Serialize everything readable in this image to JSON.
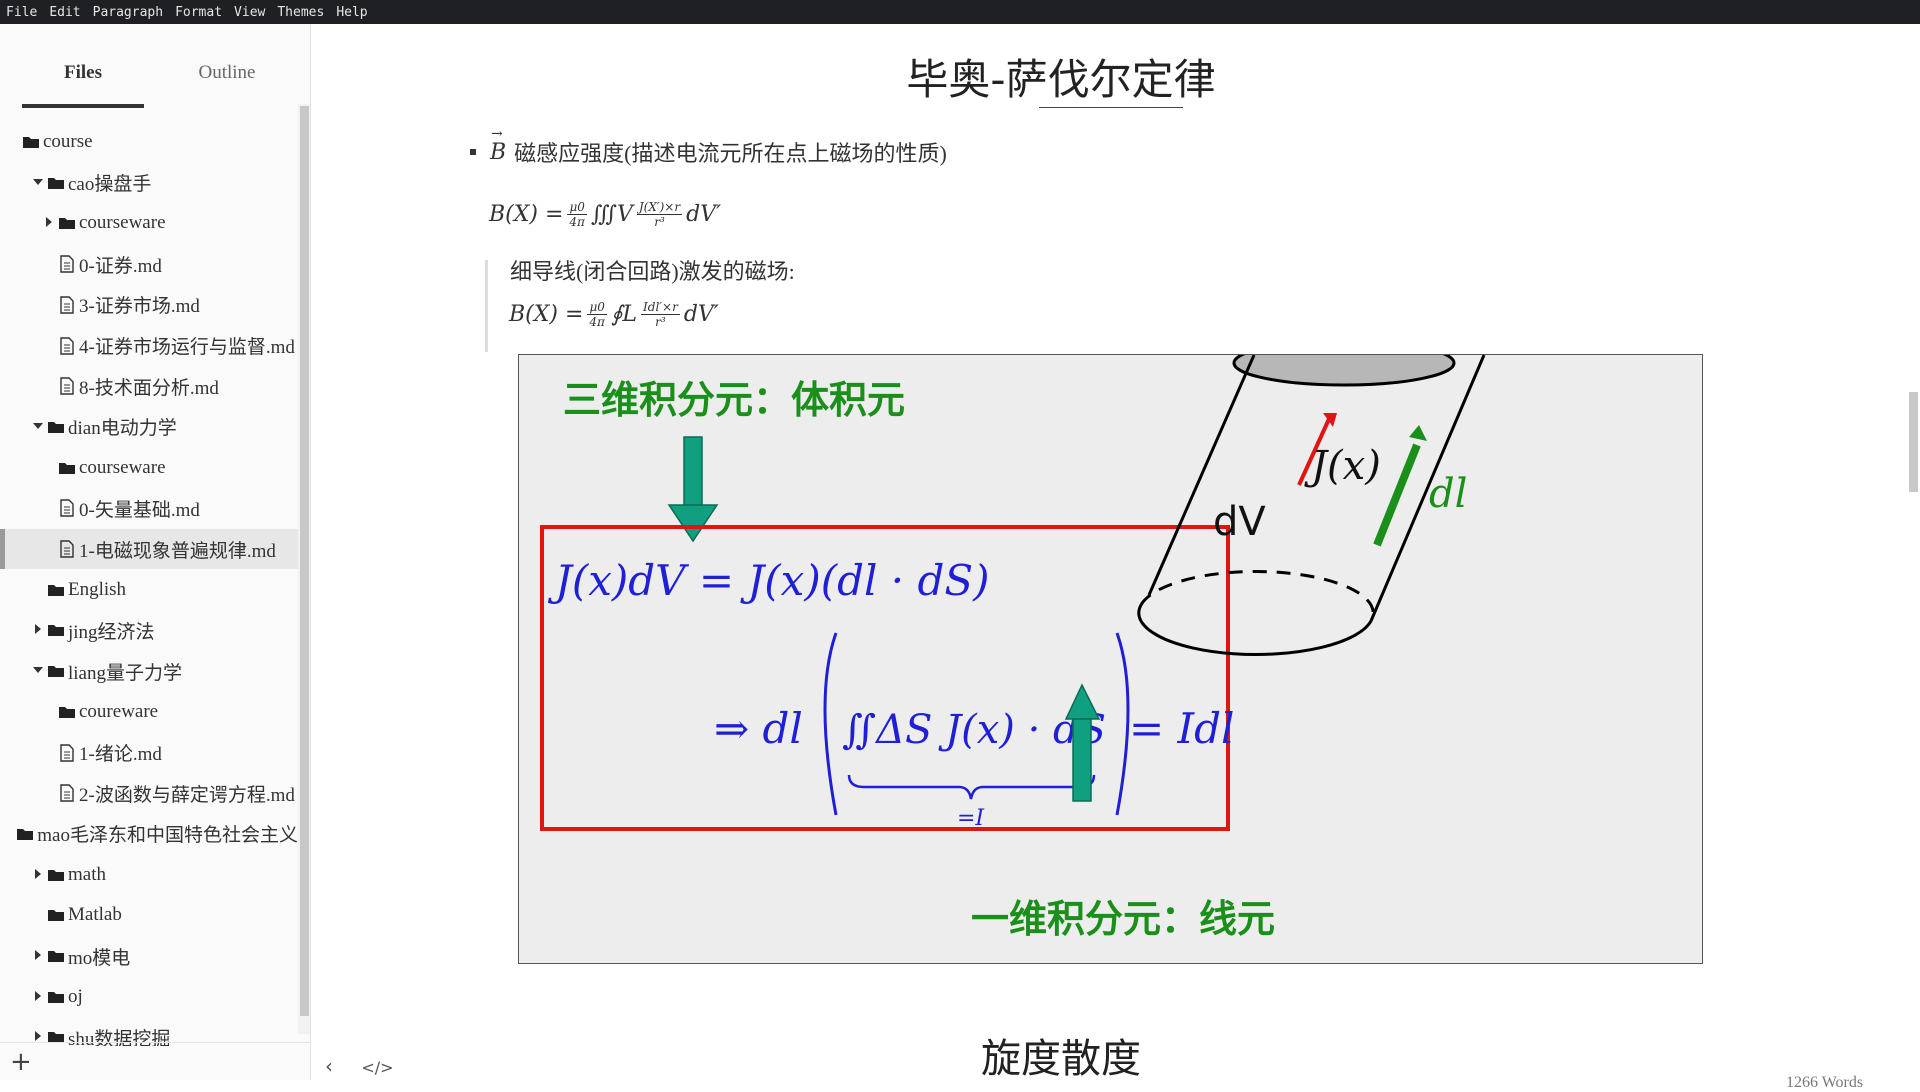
{
  "menu": [
    "File",
    "Edit",
    "Paragraph",
    "Format",
    "View",
    "Themes",
    "Help"
  ],
  "sidebar": {
    "tabs": [
      {
        "label": "Files"
      },
      {
        "label": "Outline"
      }
    ],
    "tree": [
      {
        "label": "course",
        "type": "folder",
        "arrow": "none",
        "depth": 0
      },
      {
        "label": "cao操盘手",
        "type": "folder",
        "arrow": "down",
        "depth": 1
      },
      {
        "label": "courseware",
        "type": "folder",
        "arrow": "right",
        "depth": 2
      },
      {
        "label": "0-证券.md",
        "type": "file",
        "arrow": "none",
        "depth": 2
      },
      {
        "label": "3-证券市场.md",
        "type": "file",
        "arrow": "none",
        "depth": 2
      },
      {
        "label": "4-证券市场运行与监督.md",
        "type": "file",
        "arrow": "none",
        "depth": 2
      },
      {
        "label": "8-技术面分析.md",
        "type": "file",
        "arrow": "none",
        "depth": 2
      },
      {
        "label": "dian电动力学",
        "type": "folder",
        "arrow": "down",
        "depth": 1
      },
      {
        "label": "courseware",
        "type": "folder",
        "arrow": "none",
        "depth": 2
      },
      {
        "label": "0-矢量基础.md",
        "type": "file",
        "arrow": "none",
        "depth": 2
      },
      {
        "label": "1-电磁现象普遍规律.md",
        "type": "file",
        "arrow": "none",
        "depth": 2,
        "active": true
      },
      {
        "label": "English",
        "type": "folder",
        "arrow": "none",
        "depth": 1
      },
      {
        "label": "jing经济法",
        "type": "folder",
        "arrow": "right",
        "depth": 1
      },
      {
        "label": "liang量子力学",
        "type": "folder",
        "arrow": "down",
        "depth": 1
      },
      {
        "label": "coureware",
        "type": "folder",
        "arrow": "none",
        "depth": 2
      },
      {
        "label": "1-绪论.md",
        "type": "file",
        "arrow": "none",
        "depth": 2
      },
      {
        "label": "2-波函数与薛定谔方程.md",
        "type": "file",
        "arrow": "none",
        "depth": 2
      },
      {
        "label": "mao毛泽东和中国特色社会主义",
        "type": "folder",
        "arrow": "none",
        "depth": 1
      },
      {
        "label": "math",
        "type": "folder",
        "arrow": "right",
        "depth": 1
      },
      {
        "label": "Matlab",
        "type": "folder",
        "arrow": "none",
        "depth": 1
      },
      {
        "label": "mo模电",
        "type": "folder",
        "arrow": "right",
        "depth": 1
      },
      {
        "label": "oj",
        "type": "folder",
        "arrow": "right",
        "depth": 1
      },
      {
        "label": "shu数据挖掘",
        "type": "folder",
        "arrow": "right",
        "depth": 1
      }
    ],
    "add_label": "+"
  },
  "doc": {
    "title": "毕奥-萨伐尔定律",
    "bullet_B": "B",
    "bullet_text": "磁感应强度(描述电流元所在点上磁场的性质)",
    "formula1": {
      "lhs": "B(X) =",
      "frac1_num": "μ0",
      "frac1_den": "4π",
      "integral": "∭V",
      "frac2_num": "J(X′)×r",
      "frac2_den": "r³",
      "tail": "dV′"
    },
    "quote_text": "细导线(闭合回路)激发的磁场:",
    "formula2": {
      "lhs": "B(X) =",
      "frac1_num": "μ0",
      "frac1_den": "4π",
      "integral": "∮L",
      "frac2_num": "Idl′×r",
      "frac2_den": "r³",
      "tail": "dV′"
    },
    "figure": {
      "label_3d": "三维积分元：体积元",
      "label_1d": "一维积分元：线元",
      "eq1": "J(x)dV = J(x)(dl · dS)",
      "eq2_left": "⇒ dl",
      "eq2_integral": "∬ΔS J(x) · dS",
      "eq2_right": "= Idl",
      "brace_label": "=I",
      "dV": "dV",
      "J_label": "J(x)",
      "dl_label": "dl",
      "colors": {
        "green": "#1a8f1a",
        "blue": "#1f1fd6",
        "red": "#e11414",
        "arrow_teal": "#10a080"
      }
    },
    "heading2": "旋度散度"
  },
  "footer": {
    "back_icon": "‹",
    "code_icon": "</>",
    "words": "1266 Words"
  }
}
